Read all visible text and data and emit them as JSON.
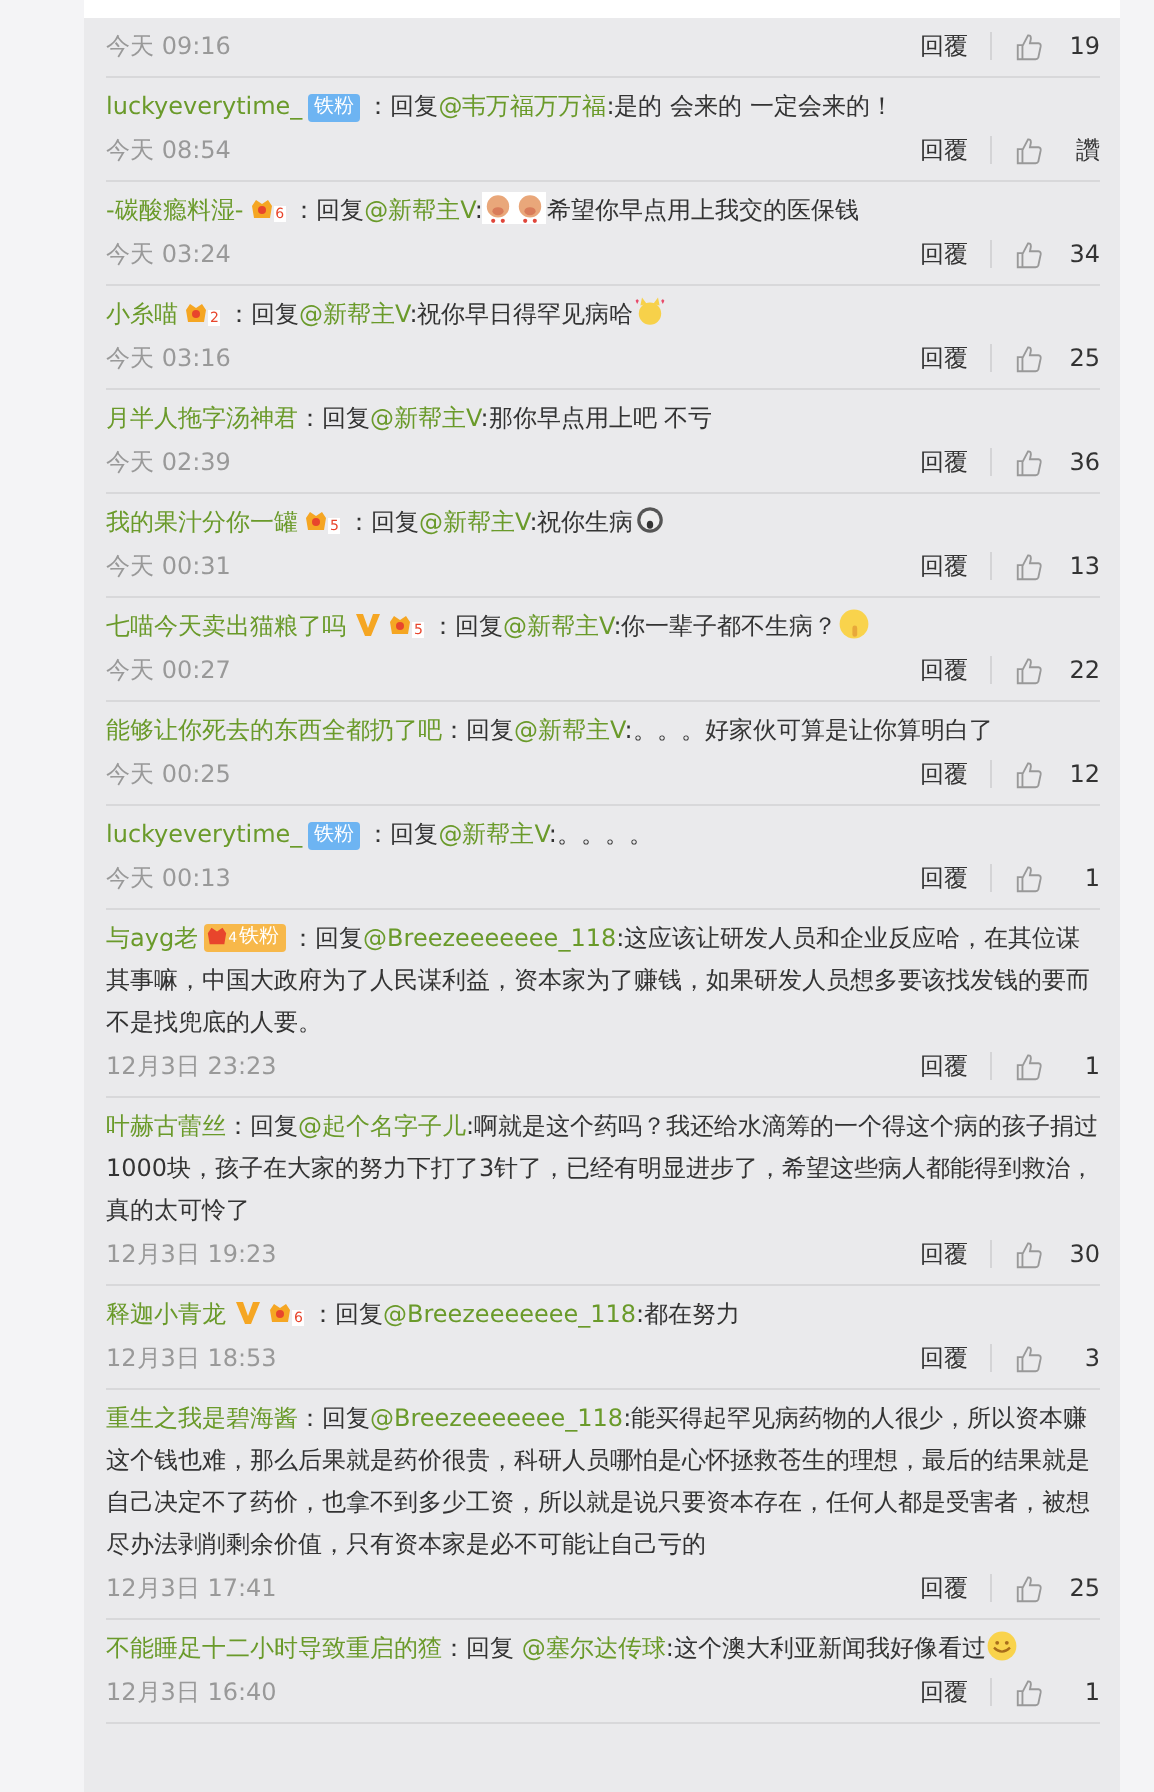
{
  "comments": [
    {
      "time": "今天 09:16",
      "reply": "回覆",
      "likes": "19"
    },
    {
      "author": "luckyeverytime_",
      "badges": [
        {
          "kind": "fan",
          "label": "铁粉"
        }
      ],
      "prefix": "：回复",
      "mention": "@韦万福万万福",
      "segments": [
        {
          "kind": "text",
          "text": ":是的 会来的 一定会来的！"
        }
      ],
      "time": "今天 08:54",
      "reply": "回覆",
      "likes": "讚"
    },
    {
      "author": "-碳酸瘾料湿-",
      "badges": [
        {
          "kind": "crown",
          "level": "6"
        }
      ],
      "prefix": "：回复",
      "mention": "@新帮主V",
      "segments": [
        {
          "kind": "text",
          "text": ":"
        },
        {
          "kind": "pig"
        },
        {
          "kind": "pig"
        },
        {
          "kind": "text",
          "text": "希望你早点用上我交的医保钱"
        }
      ],
      "time": "今天 03:24",
      "reply": "回覆",
      "likes": "34"
    },
    {
      "author": "小糸喵",
      "badges": [
        {
          "kind": "crown",
          "level": "2"
        }
      ],
      "prefix": "：回复",
      "mention": "@新帮主V",
      "segments": [
        {
          "kind": "text",
          "text": ":祝你早日得罕见病哈"
        },
        {
          "kind": "cat"
        }
      ],
      "time": "今天 03:16",
      "reply": "回覆",
      "likes": "25"
    },
    {
      "author": "月半人拖字汤神君",
      "prefix": "：回复",
      "mention": "@新帮主V",
      "segments": [
        {
          "kind": "text",
          "text": ":那你早点用上吧 不亏"
        }
      ],
      "time": "今天 02:39",
      "reply": "回覆",
      "likes": "36"
    },
    {
      "author": "我的果汁分你一罐",
      "badges": [
        {
          "kind": "crown",
          "level": "5"
        }
      ],
      "prefix": "：回复",
      "mention": "@新帮主V",
      "segments": [
        {
          "kind": "text",
          "text": ":祝你生病"
        },
        {
          "kind": "scream"
        }
      ],
      "time": "今天 00:31",
      "reply": "回覆",
      "likes": "13"
    },
    {
      "author": "七喵今天卖出猫粮了吗",
      "badges": [
        {
          "kind": "verified"
        },
        {
          "kind": "crown",
          "level": "5"
        }
      ],
      "prefix": "：回复",
      "mention": "@新帮主V",
      "segments": [
        {
          "kind": "text",
          "text": ":你一辈子都不生病？"
        },
        {
          "kind": "shush"
        }
      ],
      "time": "今天 00:27",
      "reply": "回覆",
      "likes": "22"
    },
    {
      "author": "能够让你死去的东西全都扔了吧",
      "prefix": "：回复",
      "mention": "@新帮主V",
      "segments": [
        {
          "kind": "text",
          "text": ":。。。好家伙可算是让你算明白了"
        }
      ],
      "time": "今天 00:25",
      "reply": "回覆",
      "likes": "12"
    },
    {
      "author": "luckyeverytime_",
      "badges": [
        {
          "kind": "fan",
          "label": "铁粉"
        }
      ],
      "prefix": "：回复",
      "mention": "@新帮主V",
      "segments": [
        {
          "kind": "text",
          "text": ":。。。。"
        }
      ],
      "time": "今天 00:13",
      "reply": "回覆",
      "likes": "1"
    },
    {
      "author": "与ayg老",
      "badges": [
        {
          "kind": "crown_fan",
          "level": "4",
          "label": "铁粉"
        }
      ],
      "prefix": "：回复",
      "mention": "@Breezeeeeeee_118",
      "segments": [
        {
          "kind": "text",
          "text": ":这应该让研发人员和企业反应哈，在其位谋其事嘛，中国大政府为了人民谋利益，资本家为了赚钱，如果研发人员想多要该找发钱的要而不是找兜底的人要。"
        }
      ],
      "time": "12月3日 23:23",
      "reply": "回覆",
      "likes": "1"
    },
    {
      "author": "叶赫古蕾丝",
      "prefix": "：回复",
      "mention": "@起个名字子儿",
      "segments": [
        {
          "kind": "text",
          "text": ":啊就是这个药吗？我还给水滴筹的一个得这个病的孩子捐过1000块，孩子在大家的努力下打了3针了，已经有明显进步了，希望这些病人都能得到救治，真的太可怜了"
        }
      ],
      "time": "12月3日 19:23",
      "reply": "回覆",
      "likes": "30"
    },
    {
      "author": "释迦小青龙",
      "badges": [
        {
          "kind": "verified"
        },
        {
          "kind": "crown",
          "level": "6"
        }
      ],
      "prefix": "：回复",
      "mention": "@Breezeeeeeee_118",
      "segments": [
        {
          "kind": "text",
          "text": ":都在努力"
        }
      ],
      "time": "12月3日 18:53",
      "reply": "回覆",
      "likes": "3"
    },
    {
      "author": "重生之我是碧海酱",
      "prefix": "：回复",
      "mention": "@Breezeeeeeee_118",
      "segments": [
        {
          "kind": "text",
          "text": ":能买得起罕见病药物的人很少，所以资本赚这个钱也难，那么后果就是药价很贵，科研人员哪怕是心怀拯救苍生的理想，最后的结果就是自己决定不了药价，也拿不到多少工资，所以就是说只要资本存在，任何人都是受害者，被想尽办法剥削剩余价值，只有资本家是必不可能让自己亏的"
        }
      ],
      "time": "12月3日 17:41",
      "reply": "回覆",
      "likes": "25"
    },
    {
      "author": "不能睡足十二小时导致重启的猹",
      "prefix": "：回复 ",
      "mention": "@塞尔达传球",
      "segments": [
        {
          "kind": "text",
          "text": ":这个澳大利亚新闻我好像看过"
        },
        {
          "kind": "smile"
        }
      ],
      "time": "12月3日 16:40",
      "reply": "回覆",
      "likes": "1"
    }
  ]
}
